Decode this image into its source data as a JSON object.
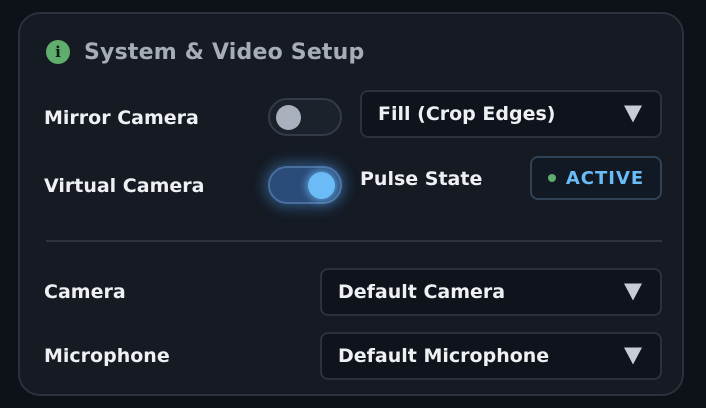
{
  "panel": {
    "title": "System & Video Setup",
    "title_icon": "info-icon",
    "accent_color": "#6bbcf6",
    "status_dot_color": "#5fae6e"
  },
  "mirror_camera": {
    "label": "Mirror Camera",
    "enabled": false,
    "fit_mode": "Fill (Crop Edges)"
  },
  "virtual_camera": {
    "label": "Virtual Camera",
    "enabled": true
  },
  "pulse": {
    "label": "Pulse State",
    "status": "ACTIVE"
  },
  "camera": {
    "label": "Camera",
    "selected": "Default Camera"
  },
  "microphone": {
    "label": "Microphone",
    "selected": "Default Microphone"
  }
}
